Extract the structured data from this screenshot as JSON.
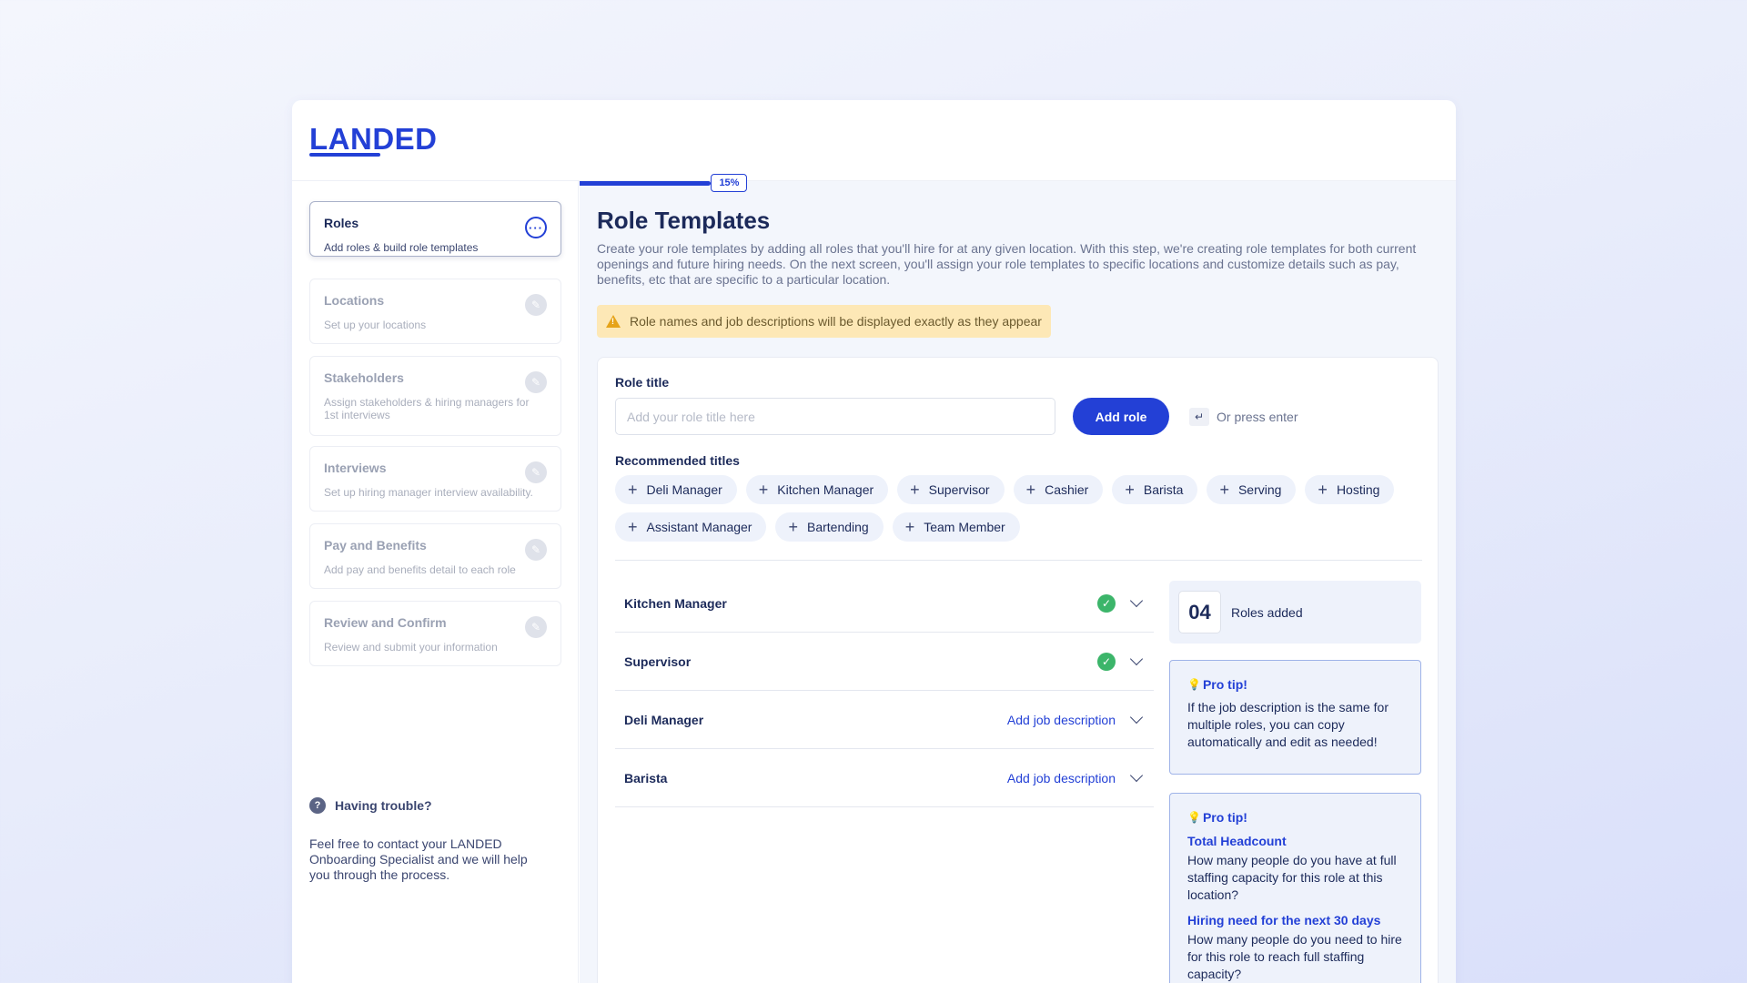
{
  "brand": {
    "logo": "LANDED"
  },
  "sidebar": {
    "steps": [
      {
        "title": "Roles",
        "subtitle": "Add roles & build role templates",
        "icon": "more-dots-icon",
        "active": true
      },
      {
        "title": "Locations",
        "subtitle": "Set up your locations",
        "icon": "pencil-icon"
      },
      {
        "title": "Stakeholders",
        "subtitle": "Assign stakeholders & hiring managers for 1st interviews",
        "icon": "pencil-icon"
      },
      {
        "title": "Interviews",
        "subtitle": "Set up hiring manager interview availability.",
        "icon": "pencil-icon"
      },
      {
        "title": "Pay and Benefits",
        "subtitle": "Add pay and benefits detail to each role",
        "icon": "pencil-icon"
      },
      {
        "title": "Review and Confirm",
        "subtitle": "Review and submit your information",
        "icon": "pencil-icon"
      }
    ],
    "trouble": {
      "title": "Having trouble?",
      "text": "Feel free to contact your LANDED Onboarding Specialist and we will help you through the process."
    }
  },
  "progress": {
    "percent": 15,
    "label": "15%"
  },
  "main": {
    "title": "Role Templates",
    "description": "Create your role templates by adding all roles that you'll hire for at any given location. With this step, we're creating role templates for both current openings and future hiring needs. On the next screen, you'll assign your role templates to specific locations and customize details such as pay, benefits, etc that are specific to a particular location.",
    "warning": "Role names and job descriptions will be displayed exactly as they appear",
    "role_title_label": "Role title",
    "role_input": {
      "value": "",
      "placeholder": "Add your role title here"
    },
    "add_role_label": "Add role",
    "enter_hint": "Or press enter",
    "enter_key_glyph": "↵",
    "recommended_label": "Recommended titles",
    "recommended": [
      "Deli Manager",
      "Kitchen Manager",
      "Supervisor",
      "Cashier",
      "Barista",
      "Serving",
      "Hosting",
      "Assistant Manager",
      "Bartending",
      "Team Member"
    ],
    "roles": [
      {
        "name": "Kitchen Manager",
        "status": "complete"
      },
      {
        "name": "Supervisor",
        "status": "complete"
      },
      {
        "name": "Deli Manager",
        "status": "pending",
        "action": "Add job description"
      },
      {
        "name": "Barista",
        "status": "pending",
        "action": "Add job description"
      }
    ],
    "roles_count": {
      "value": "04",
      "label": "Roles added"
    },
    "tips": [
      {
        "head": "Pro tip!",
        "text": "If the job description is the same for multiple roles, you can copy automatically and edit as needed!"
      },
      {
        "head": "Pro tip!",
        "sections": [
          {
            "title": "Total Headcount",
            "text": "How many people do you have at full staffing capacity for this role at this location?"
          },
          {
            "title": "Hiring need for the next 30 days",
            "text": "How many people do you need to hire for this role to reach full staffing capacity?"
          }
        ]
      }
    ]
  },
  "colors": {
    "accent": "#2340d6",
    "success": "#3cb56a",
    "warning_bg": "#fde8b6",
    "warning_icon": "#e6a318"
  }
}
